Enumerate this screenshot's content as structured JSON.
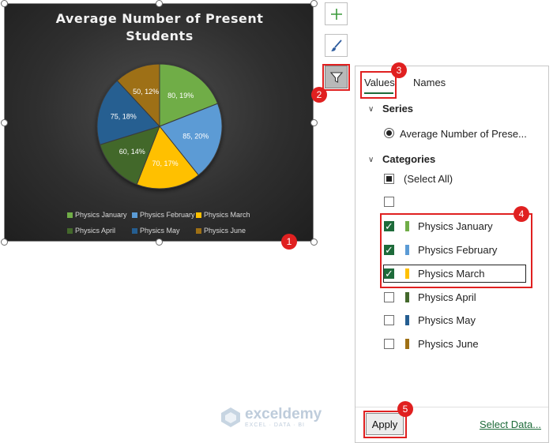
{
  "chart": {
    "title_line1": "Average Number of Present",
    "title_line2": "Students",
    "legend": [
      {
        "label": "Physics January",
        "color": "#70ad47"
      },
      {
        "label": "Physics February",
        "color": "#5b9bd5"
      },
      {
        "label": "Physics March",
        "color": "#ffc000"
      },
      {
        "label": "Physics April",
        "color": "#43682b"
      },
      {
        "label": "Physics May",
        "color": "#255e91"
      },
      {
        "label": "Physics June",
        "color": "#9e7015"
      }
    ]
  },
  "chart_data": {
    "type": "pie",
    "title": "Average Number of Present Students",
    "categories": [
      "Physics January",
      "Physics February",
      "Physics March",
      "Physics April",
      "Physics May",
      "Physics June"
    ],
    "values": [
      80,
      85,
      70,
      60,
      75,
      50
    ],
    "labels": [
      "80, 19%",
      "85, 20%",
      "70, 17%",
      "60, 14%",
      "75, 18%",
      "50, 12%"
    ],
    "colors": [
      "#70ad47",
      "#5b9bd5",
      "#ffc000",
      "#43682b",
      "#255e91",
      "#9e7015"
    ],
    "legend_position": "bottom"
  },
  "toolbar": {
    "chart_elements_icon": "plus-icon",
    "chart_styles_icon": "brush-icon",
    "chart_filters_icon": "funnel-icon"
  },
  "panel": {
    "tabs": [
      "Values",
      "Names"
    ],
    "series_heading": "Series",
    "series_item": "Average Number of Prese...",
    "categories_heading": "Categories",
    "select_all": "(Select All)",
    "items": [
      {
        "label": "Physics January",
        "checked": true,
        "color": "#70ad47"
      },
      {
        "label": "Physics February",
        "checked": true,
        "color": "#5b9bd5"
      },
      {
        "label": "Physics March",
        "checked": true,
        "color": "#ffc000"
      },
      {
        "label": "Physics April",
        "checked": false,
        "color": "#43682b"
      },
      {
        "label": "Physics May",
        "checked": false,
        "color": "#255e91"
      },
      {
        "label": "Physics June",
        "checked": false,
        "color": "#9e7015"
      }
    ],
    "apply": "Apply",
    "select_data": "Select Data..."
  },
  "badges": [
    "1",
    "2",
    "3",
    "4",
    "5"
  ],
  "watermark": {
    "name": "exceldemy",
    "tagline": "EXCEL · DATA · BI"
  },
  "colors": {
    "accent_green": "#1e6b3a",
    "annotation_red": "#e02020"
  }
}
